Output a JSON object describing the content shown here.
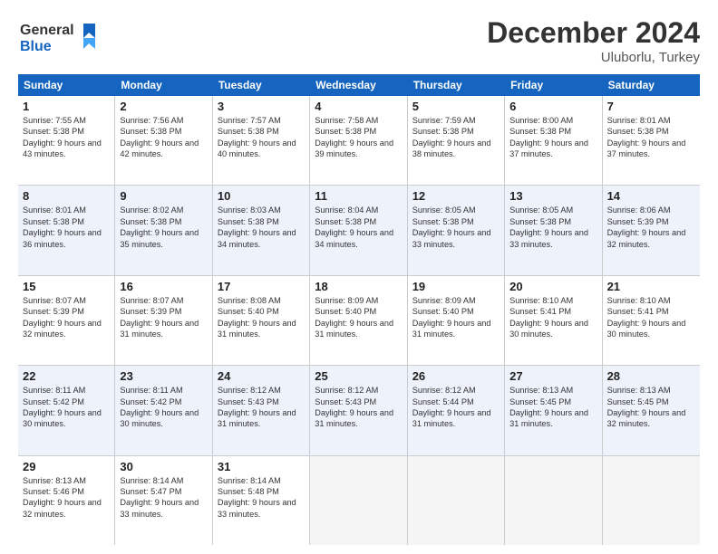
{
  "logo": {
    "line1": "General",
    "line2": "Blue"
  },
  "title": "December 2024",
  "location": "Uluborlu, Turkey",
  "weekdays": [
    "Sunday",
    "Monday",
    "Tuesday",
    "Wednesday",
    "Thursday",
    "Friday",
    "Saturday"
  ],
  "weeks": [
    [
      {
        "day": "1",
        "sunrise": "Sunrise: 7:55 AM",
        "sunset": "Sunset: 5:38 PM",
        "daylight": "Daylight: 9 hours and 43 minutes."
      },
      {
        "day": "2",
        "sunrise": "Sunrise: 7:56 AM",
        "sunset": "Sunset: 5:38 PM",
        "daylight": "Daylight: 9 hours and 42 minutes."
      },
      {
        "day": "3",
        "sunrise": "Sunrise: 7:57 AM",
        "sunset": "Sunset: 5:38 PM",
        "daylight": "Daylight: 9 hours and 40 minutes."
      },
      {
        "day": "4",
        "sunrise": "Sunrise: 7:58 AM",
        "sunset": "Sunset: 5:38 PM",
        "daylight": "Daylight: 9 hours and 39 minutes."
      },
      {
        "day": "5",
        "sunrise": "Sunrise: 7:59 AM",
        "sunset": "Sunset: 5:38 PM",
        "daylight": "Daylight: 9 hours and 38 minutes."
      },
      {
        "day": "6",
        "sunrise": "Sunrise: 8:00 AM",
        "sunset": "Sunset: 5:38 PM",
        "daylight": "Daylight: 9 hours and 37 minutes."
      },
      {
        "day": "7",
        "sunrise": "Sunrise: 8:01 AM",
        "sunset": "Sunset: 5:38 PM",
        "daylight": "Daylight: 9 hours and 37 minutes."
      }
    ],
    [
      {
        "day": "8",
        "sunrise": "Sunrise: 8:01 AM",
        "sunset": "Sunset: 5:38 PM",
        "daylight": "Daylight: 9 hours and 36 minutes."
      },
      {
        "day": "9",
        "sunrise": "Sunrise: 8:02 AM",
        "sunset": "Sunset: 5:38 PM",
        "daylight": "Daylight: 9 hours and 35 minutes."
      },
      {
        "day": "10",
        "sunrise": "Sunrise: 8:03 AM",
        "sunset": "Sunset: 5:38 PM",
        "daylight": "Daylight: 9 hours and 34 minutes."
      },
      {
        "day": "11",
        "sunrise": "Sunrise: 8:04 AM",
        "sunset": "Sunset: 5:38 PM",
        "daylight": "Daylight: 9 hours and 34 minutes."
      },
      {
        "day": "12",
        "sunrise": "Sunrise: 8:05 AM",
        "sunset": "Sunset: 5:38 PM",
        "daylight": "Daylight: 9 hours and 33 minutes."
      },
      {
        "day": "13",
        "sunrise": "Sunrise: 8:05 AM",
        "sunset": "Sunset: 5:38 PM",
        "daylight": "Daylight: 9 hours and 33 minutes."
      },
      {
        "day": "14",
        "sunrise": "Sunrise: 8:06 AM",
        "sunset": "Sunset: 5:39 PM",
        "daylight": "Daylight: 9 hours and 32 minutes."
      }
    ],
    [
      {
        "day": "15",
        "sunrise": "Sunrise: 8:07 AM",
        "sunset": "Sunset: 5:39 PM",
        "daylight": "Daylight: 9 hours and 32 minutes."
      },
      {
        "day": "16",
        "sunrise": "Sunrise: 8:07 AM",
        "sunset": "Sunset: 5:39 PM",
        "daylight": "Daylight: 9 hours and 31 minutes."
      },
      {
        "day": "17",
        "sunrise": "Sunrise: 8:08 AM",
        "sunset": "Sunset: 5:40 PM",
        "daylight": "Daylight: 9 hours and 31 minutes."
      },
      {
        "day": "18",
        "sunrise": "Sunrise: 8:09 AM",
        "sunset": "Sunset: 5:40 PM",
        "daylight": "Daylight: 9 hours and 31 minutes."
      },
      {
        "day": "19",
        "sunrise": "Sunrise: 8:09 AM",
        "sunset": "Sunset: 5:40 PM",
        "daylight": "Daylight: 9 hours and 31 minutes."
      },
      {
        "day": "20",
        "sunrise": "Sunrise: 8:10 AM",
        "sunset": "Sunset: 5:41 PM",
        "daylight": "Daylight: 9 hours and 30 minutes."
      },
      {
        "day": "21",
        "sunrise": "Sunrise: 8:10 AM",
        "sunset": "Sunset: 5:41 PM",
        "daylight": "Daylight: 9 hours and 30 minutes."
      }
    ],
    [
      {
        "day": "22",
        "sunrise": "Sunrise: 8:11 AM",
        "sunset": "Sunset: 5:42 PM",
        "daylight": "Daylight: 9 hours and 30 minutes."
      },
      {
        "day": "23",
        "sunrise": "Sunrise: 8:11 AM",
        "sunset": "Sunset: 5:42 PM",
        "daylight": "Daylight: 9 hours and 30 minutes."
      },
      {
        "day": "24",
        "sunrise": "Sunrise: 8:12 AM",
        "sunset": "Sunset: 5:43 PM",
        "daylight": "Daylight: 9 hours and 31 minutes."
      },
      {
        "day": "25",
        "sunrise": "Sunrise: 8:12 AM",
        "sunset": "Sunset: 5:43 PM",
        "daylight": "Daylight: 9 hours and 31 minutes."
      },
      {
        "day": "26",
        "sunrise": "Sunrise: 8:12 AM",
        "sunset": "Sunset: 5:44 PM",
        "daylight": "Daylight: 9 hours and 31 minutes."
      },
      {
        "day": "27",
        "sunrise": "Sunrise: 8:13 AM",
        "sunset": "Sunset: 5:45 PM",
        "daylight": "Daylight: 9 hours and 31 minutes."
      },
      {
        "day": "28",
        "sunrise": "Sunrise: 8:13 AM",
        "sunset": "Sunset: 5:45 PM",
        "daylight": "Daylight: 9 hours and 32 minutes."
      }
    ],
    [
      {
        "day": "29",
        "sunrise": "Sunrise: 8:13 AM",
        "sunset": "Sunset: 5:46 PM",
        "daylight": "Daylight: 9 hours and 32 minutes."
      },
      {
        "day": "30",
        "sunrise": "Sunrise: 8:14 AM",
        "sunset": "Sunset: 5:47 PM",
        "daylight": "Daylight: 9 hours and 33 minutes."
      },
      {
        "day": "31",
        "sunrise": "Sunrise: 8:14 AM",
        "sunset": "Sunset: 5:48 PM",
        "daylight": "Daylight: 9 hours and 33 minutes."
      },
      null,
      null,
      null,
      null
    ]
  ]
}
